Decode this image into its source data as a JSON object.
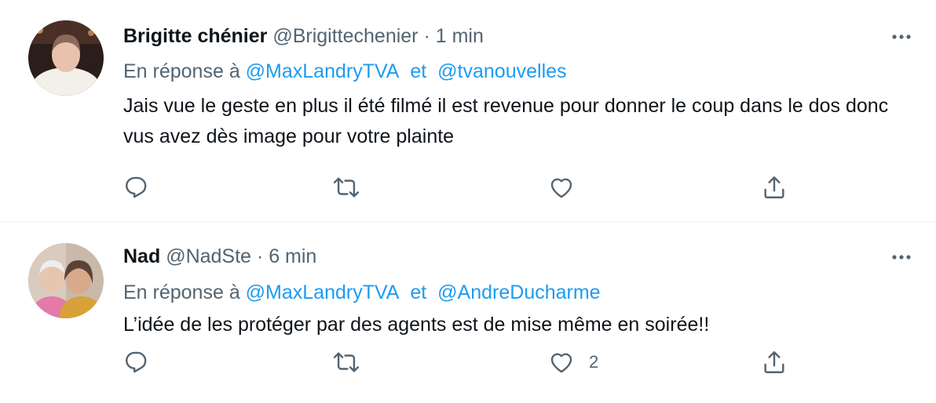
{
  "tweets": [
    {
      "name": "Brigitte chénier",
      "handle": "@Brigittechenier",
      "separator": "·",
      "time": "1 min",
      "reply_prefix": "En réponse à",
      "mention1": "@MaxLandryTVA",
      "joiner": "et",
      "mention2": "@tvanouvelles",
      "text": "Jais vue le geste en plus il été filmé il est revenue pour donner le coup dans le dos donc vus avez dès image pour votre plainte",
      "like_count": ""
    },
    {
      "name": "Nad",
      "handle": "@NadSte",
      "separator": "·",
      "time": "6 min",
      "reply_prefix": "En réponse à",
      "mention1": "@MaxLandryTVA",
      "joiner": "et",
      "mention2": "@AndreDucharme",
      "text": "L’idée de les protéger par des agents est de mise même en soirée!!",
      "like_count": "2"
    }
  ],
  "icons": {
    "reply": "reply-icon",
    "retweet": "retweet-icon",
    "like": "heart-icon",
    "share": "share-icon",
    "more": "more-icon"
  },
  "colors": {
    "text": "#0f1419",
    "secondary": "#536471",
    "link": "#1d9bf0",
    "divider": "#eff3f4"
  }
}
